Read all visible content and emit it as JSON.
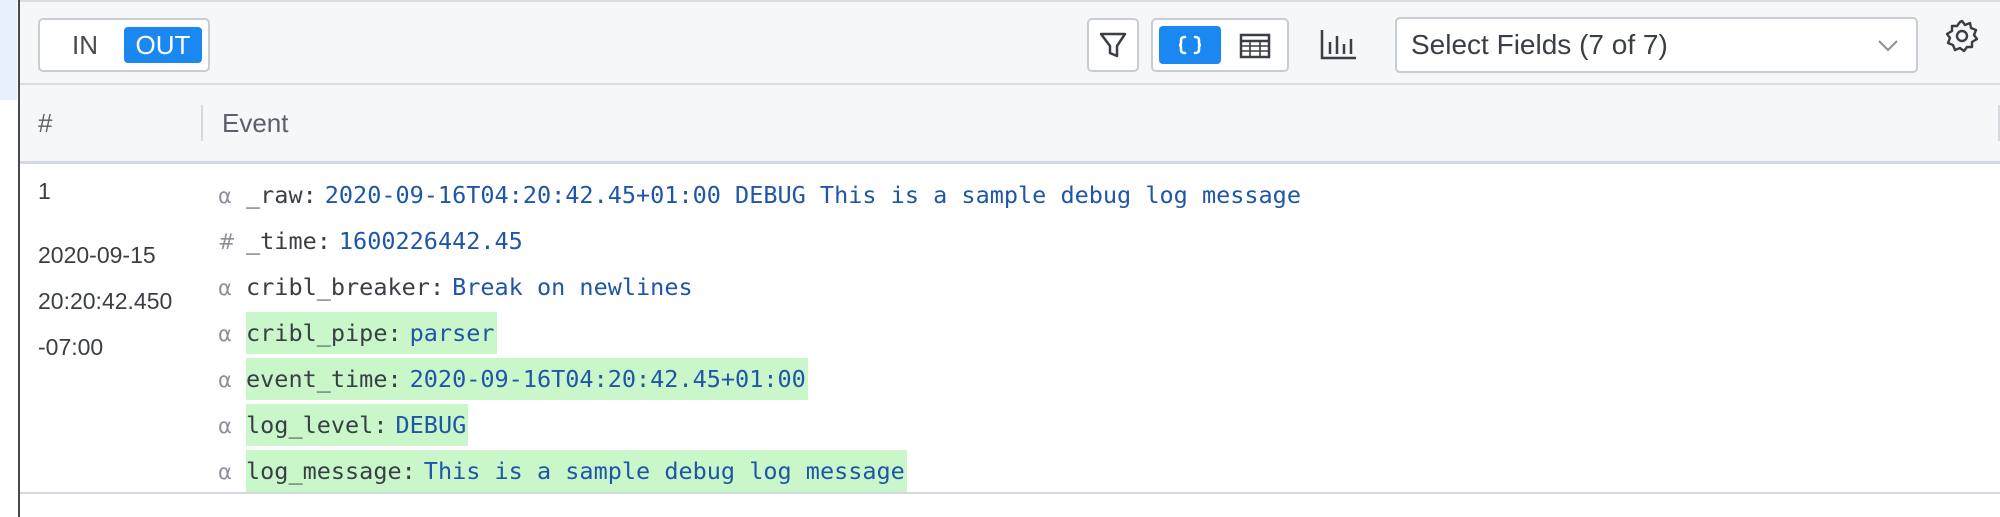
{
  "toolbar": {
    "toggle": {
      "in_label": "IN",
      "out_label": "OUT",
      "selected": "OUT"
    },
    "select_fields_label": "Select Fields (7 of 7)",
    "colors": {
      "accent": "#1a88f0",
      "added_highlight": "#c9f7c9"
    },
    "icons": {
      "filter": "filter-funnel-icon",
      "json_view": "json-braces-icon",
      "table_view": "table-icon",
      "chart": "bar-chart-icon",
      "dropdown": "chevron-down-icon",
      "settings": "gear-icon"
    }
  },
  "table": {
    "headers": {
      "index": "#",
      "event": "Event"
    }
  },
  "event": {
    "index": "1",
    "timestamp": {
      "date": "2020-09-15",
      "time": "20:20:42.450",
      "tz": "-07:00"
    },
    "fields": [
      {
        "type_symbol": "α",
        "name": "_raw",
        "value": "2020-09-16T04:20:42.45+01:00 DEBUG This is a sample debug log message",
        "added": false
      },
      {
        "type_symbol": "#",
        "name": "_time",
        "value": "1600226442.45",
        "added": false
      },
      {
        "type_symbol": "α",
        "name": "cribl_breaker",
        "value": "Break on newlines",
        "added": false
      },
      {
        "type_symbol": "α",
        "name": "cribl_pipe",
        "value": "parser",
        "added": true
      },
      {
        "type_symbol": "α",
        "name": "event_time",
        "value": "2020-09-16T04:20:42.45+01:00",
        "added": true
      },
      {
        "type_symbol": "α",
        "name": "log_level",
        "value": "DEBUG",
        "added": true
      },
      {
        "type_symbol": "α",
        "name": "log_message",
        "value": "This is a sample debug log message",
        "added": true
      }
    ]
  }
}
